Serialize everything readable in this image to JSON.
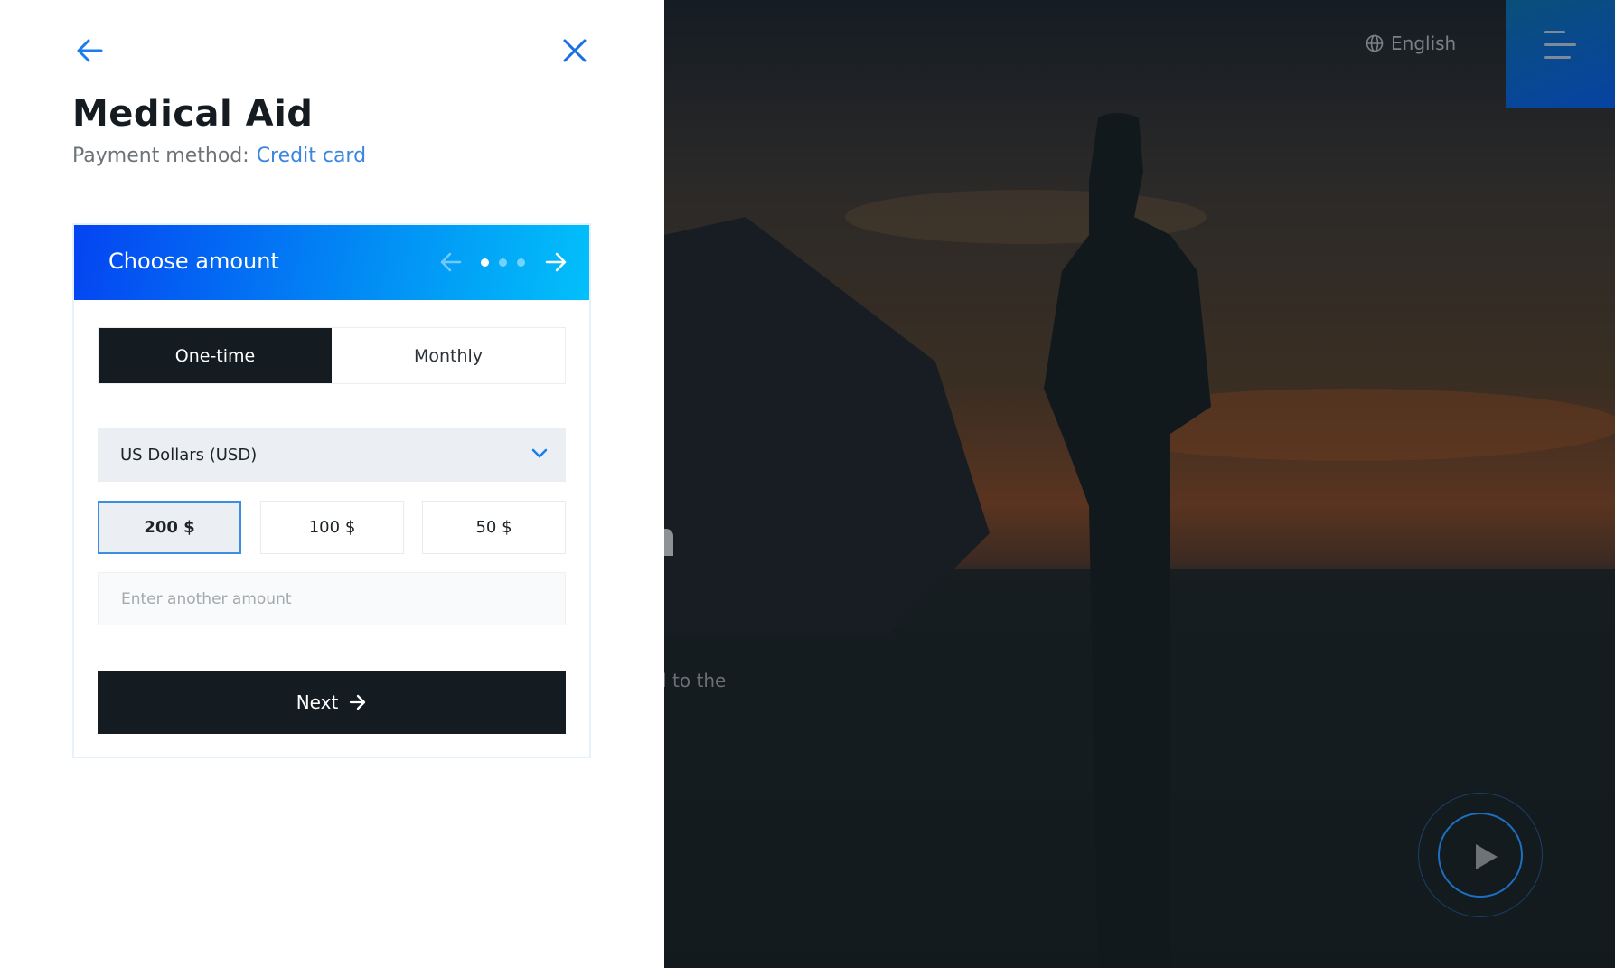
{
  "panel": {
    "back_icon": "arrow-left-icon",
    "close_icon": "close-icon",
    "title": "Medical Aid",
    "payment_label": "Payment method:",
    "payment_value": "Credit card"
  },
  "card": {
    "header_title": "Choose amount",
    "step_current": 1,
    "step_total": 3,
    "frequency_tabs": [
      {
        "label": "One-time",
        "active": true
      },
      {
        "label": "Monthly",
        "active": false
      }
    ],
    "currency": "US Dollars (USD)",
    "amounts": [
      {
        "label": "200 $",
        "selected": true
      },
      {
        "label": "100 $",
        "selected": false
      },
      {
        "label": "50 $",
        "selected": false
      }
    ],
    "other_amount_placeholder": "Enter another amount",
    "next_label": "Next"
  },
  "background": {
    "language": "English",
    "partial_text": "d to the",
    "play_icon": "play-icon",
    "menu_icon": "hamburger-menu-icon"
  },
  "colors": {
    "accent": "#3a86e0",
    "dark": "#141c21",
    "gradient_start": "#0444f2",
    "gradient_end": "#02c0fa"
  }
}
